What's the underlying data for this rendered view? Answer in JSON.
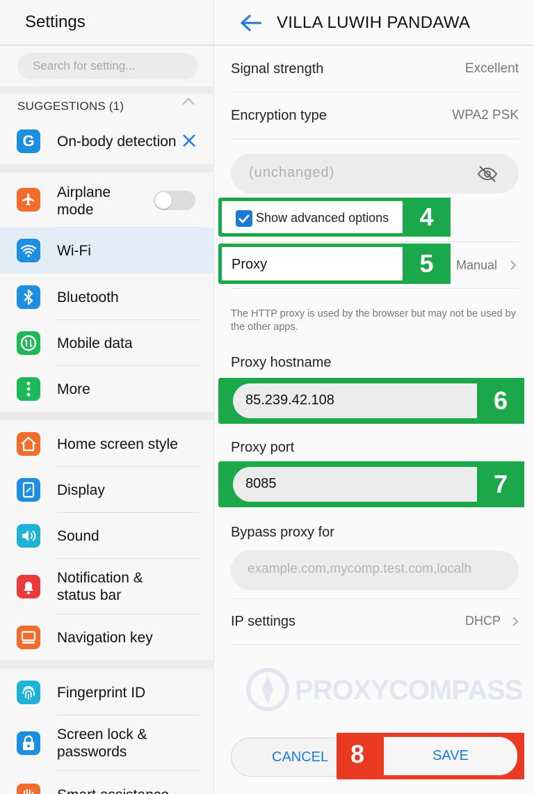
{
  "left": {
    "title": "Settings",
    "search_placeholder": "Search for setting...",
    "suggestions_header": "SUGGESTIONS (1)",
    "suggestion_item": "On-body detection",
    "items": [
      {
        "label": "Airplane mode",
        "icon": "airplane-icon",
        "color": "#f26c2b",
        "toggle": false
      },
      {
        "label": "Wi-Fi",
        "icon": "wifi-icon",
        "color": "#1e8fe0",
        "selected": true
      },
      {
        "label": "Bluetooth",
        "icon": "bluetooth-icon",
        "color": "#1e8fe0"
      },
      {
        "label": "Mobile data",
        "icon": "mobile-data-icon",
        "color": "#1cb85a"
      },
      {
        "label": "More",
        "icon": "more-icon",
        "color": "#1cb85a"
      },
      {
        "label": "Home screen style",
        "icon": "home-icon",
        "color": "#f26c2b"
      },
      {
        "label": "Display",
        "icon": "display-icon",
        "color": "#1e8fe0"
      },
      {
        "label": "Sound",
        "icon": "sound-icon",
        "color": "#1eb3d6"
      },
      {
        "label": "Notification & status bar",
        "icon": "bell-icon",
        "color": "#ea3a3a"
      },
      {
        "label": "Navigation key",
        "icon": "navigation-icon",
        "color": "#f26c2b"
      },
      {
        "label": "Fingerprint ID",
        "icon": "fingerprint-icon",
        "color": "#1eb3d6"
      },
      {
        "label": "Screen lock & passwords",
        "icon": "lock-icon",
        "color": "#1e8fe0"
      },
      {
        "label": "Smart assistance",
        "icon": "hand-icon",
        "color": "#f26c2b"
      }
    ]
  },
  "right": {
    "title": "VILLA LUWIH PANDAWA",
    "signal_label": "Signal strength",
    "signal_value": "Excellent",
    "encryption_label": "Encryption type",
    "encryption_value": "WPA2 PSK",
    "password_placeholder": "(unchanged)",
    "advanced_label": "Show advanced options",
    "advanced_checked": true,
    "proxy_label": "Proxy",
    "proxy_value": "Manual",
    "proxy_note": "The HTTP proxy is used by the browser but may not be used by the other apps.",
    "hostname_label": "Proxy hostname",
    "hostname_value": "85.239.42.108",
    "port_label": "Proxy port",
    "port_value": "8085",
    "bypass_label": "Bypass proxy for",
    "bypass_placeholder": "example.com,mycomp.test.com,localh",
    "ip_label": "IP settings",
    "ip_value": "DHCP",
    "watermark": "PROXYCOMPASS",
    "cancel_label": "CANCEL",
    "save_label": "SAVE"
  },
  "step_badges": {
    "advanced": "4",
    "proxy": "5",
    "hostname": "6",
    "port": "7",
    "save": "8"
  },
  "colors": {
    "accent": "#1e78d7",
    "highlight": "#1aa84a",
    "save_highlight": "#ea3a22"
  }
}
